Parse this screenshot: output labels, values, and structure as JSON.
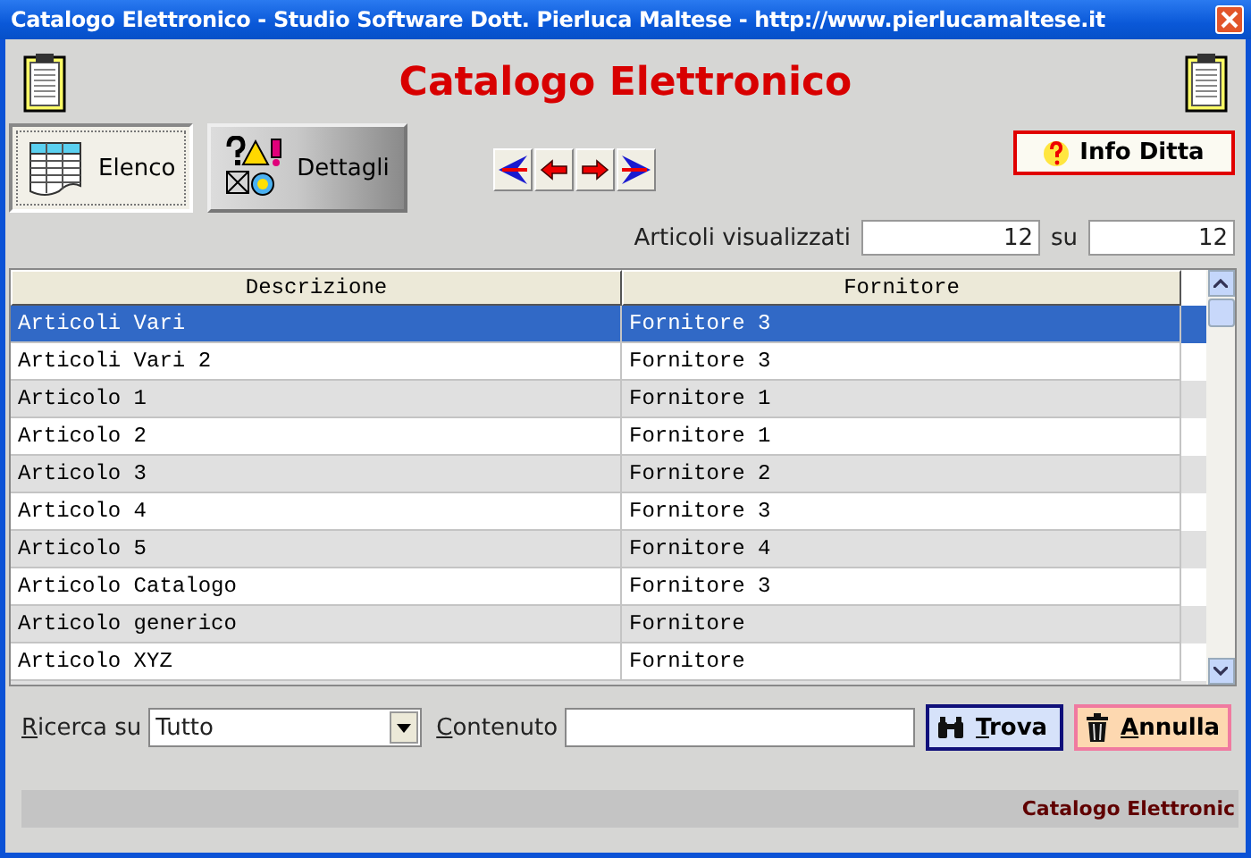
{
  "window": {
    "title": "Catalogo Elettronico - Studio Software Dott. Pierluca Maltese - http://www.pierlucamaltese.it"
  },
  "header": {
    "title": "Catalogo Elettronico"
  },
  "tabs": [
    {
      "label": "Elenco",
      "kind": "list",
      "selected": true
    },
    {
      "label": "Dettagli",
      "kind": "details",
      "selected": false
    }
  ],
  "nav_buttons": [
    {
      "kind": "first"
    },
    {
      "kind": "previous"
    },
    {
      "kind": "next"
    },
    {
      "kind": "last"
    }
  ],
  "info_button": "Info Ditta",
  "counter": {
    "label": "Articoli visualizzati",
    "shown": "12",
    "separator": "su",
    "total": "12"
  },
  "table": {
    "columns": [
      "Descrizione",
      "Fornitore"
    ],
    "rows": [
      {
        "cells": [
          "Articoli Vari",
          "Fornitore 3"
        ],
        "selected": true
      },
      {
        "cells": [
          "Articoli Vari 2",
          "Fornitore 3"
        ],
        "selected": false
      },
      {
        "cells": [
          "Articolo 1",
          "Fornitore 1"
        ],
        "selected": false
      },
      {
        "cells": [
          "Articolo 2",
          "Fornitore 1"
        ],
        "selected": false
      },
      {
        "cells": [
          "Articolo 3",
          "Fornitore 2"
        ],
        "selected": false
      },
      {
        "cells": [
          "Articolo 4",
          "Fornitore 3"
        ],
        "selected": false
      },
      {
        "cells": [
          "Articolo 5",
          "Fornitore 4"
        ],
        "selected": false
      },
      {
        "cells": [
          "Articolo Catalogo",
          "Fornitore 3"
        ],
        "selected": false
      },
      {
        "cells": [
          "Articolo generico",
          "Fornitore"
        ],
        "selected": false
      },
      {
        "cells": [
          "Articolo XYZ",
          "Fornitore"
        ],
        "selected": false
      }
    ]
  },
  "search": {
    "field_label": "Ricerca su",
    "field_value": "Tutto",
    "content_label": "Contenuto",
    "find_button": "Trova",
    "cancel_button": "Annulla"
  },
  "status_bar": {
    "text": "Catalogo Elettronic"
  }
}
